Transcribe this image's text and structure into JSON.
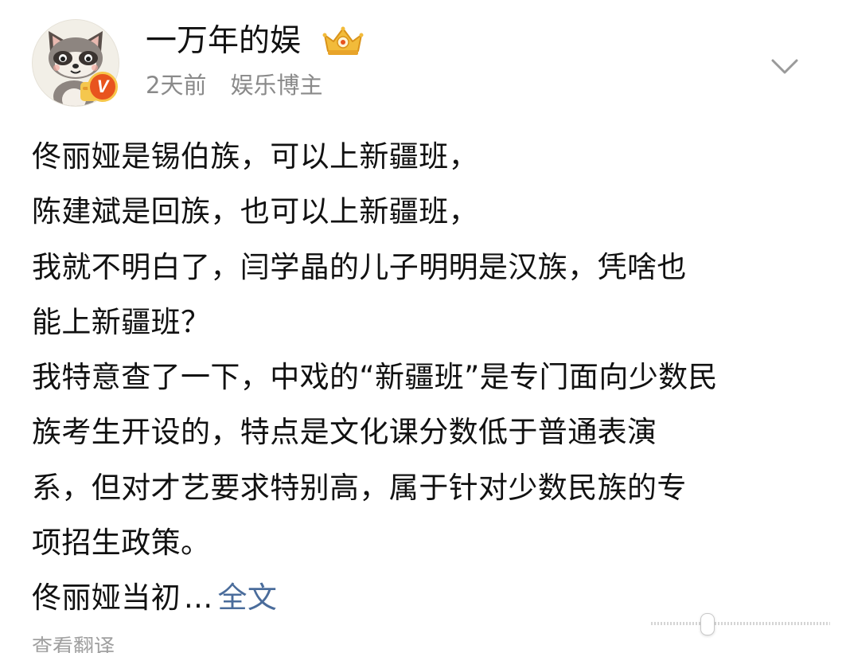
{
  "author": {
    "name": "一万年的娱",
    "verified_badge": "V",
    "avatar_icon": "raccoon-avatar-icon",
    "level_icon": "crown-icon"
  },
  "post": {
    "time": "2天前",
    "tag": "娱乐博主",
    "lines": [
      "佟丽娅是锡伯族，可以上新疆班，",
      "陈建斌是回族，也可以上新疆班，",
      "我就不明白了，闫学晶的儿子明明是汉族，凭啥也",
      "能上新疆班？",
      "我特意查了一下，中戏的“新疆班”是专门面向少数民",
      "族考生开设的，特点是文化课分数低于普通表演",
      "系，但对才艺要求特别高，属于针对少数民族的专",
      "项招生政策。"
    ],
    "last_line": "佟丽娅当初",
    "ellipsis": "...",
    "expand_label": "全文"
  },
  "translate_label": "查看翻译",
  "colors": {
    "link": "#4a6c9b",
    "meta": "#8a8a8a",
    "badge": "#e8541e"
  }
}
